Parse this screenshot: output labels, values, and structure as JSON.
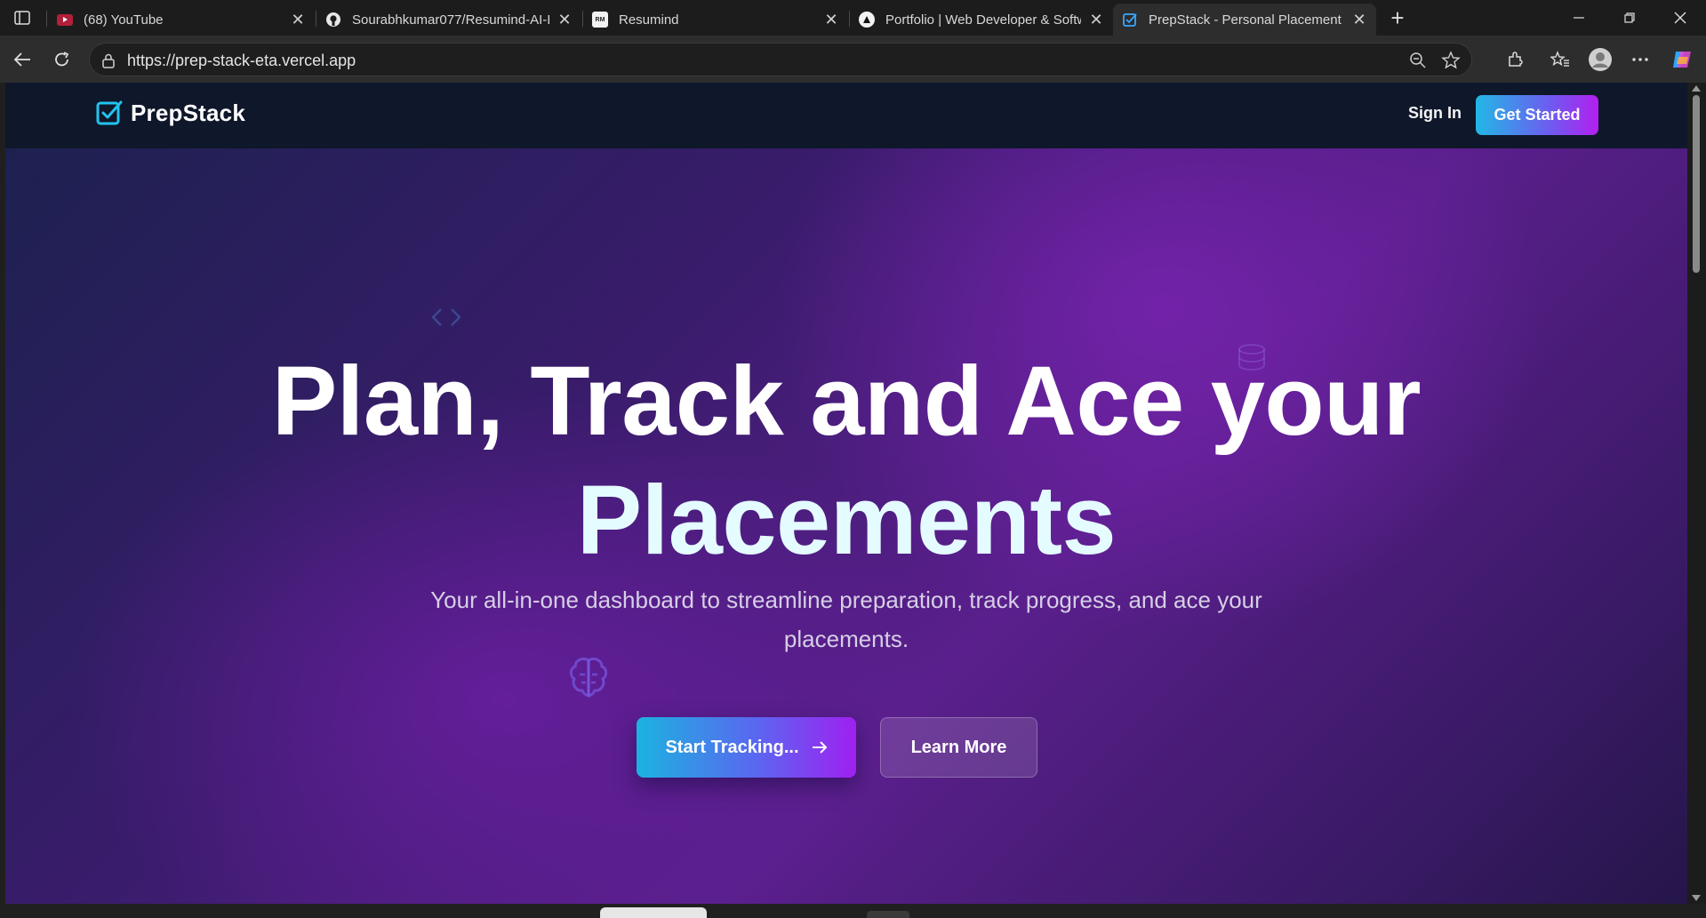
{
  "browser": {
    "tabs": [
      {
        "title": "(68) YouTube",
        "favicon": "youtube-icon",
        "active": false
      },
      {
        "title": "Sourabhkumar077/Resumind-AI-I",
        "favicon": "github-icon",
        "active": false
      },
      {
        "title": "Resumind",
        "favicon": "resumind-icon",
        "active": false
      },
      {
        "title": "Portfolio | Web Developer & Softw",
        "favicon": "triangle-icon",
        "active": false
      },
      {
        "title": "PrepStack - Personal Placement Tr",
        "favicon": "prepstack-icon",
        "active": true
      }
    ],
    "close_glyph": "✕",
    "new_tab_glyph": "+",
    "url": "https://prep-stack-eta.vercel.app"
  },
  "site": {
    "brand": "PrepStack",
    "nav": {
      "sign_in": "Sign In",
      "get_started": "Get Started"
    },
    "hero": {
      "title_line1": "Plan, Track and Ace your",
      "title_line2": "Placements",
      "subtitle_line1": "Your all-in-one dashboard to streamline preparation, track progress, and ace your",
      "subtitle_line2": "placements.",
      "primary_cta": "Start Tracking...",
      "secondary_cta": "Learn More"
    },
    "colors": {
      "nav_bg": "#0f172a",
      "accent_cyan": "#22b8e6",
      "accent_purple": "#a020f0",
      "hero_purple": "#5a1f8c"
    }
  }
}
